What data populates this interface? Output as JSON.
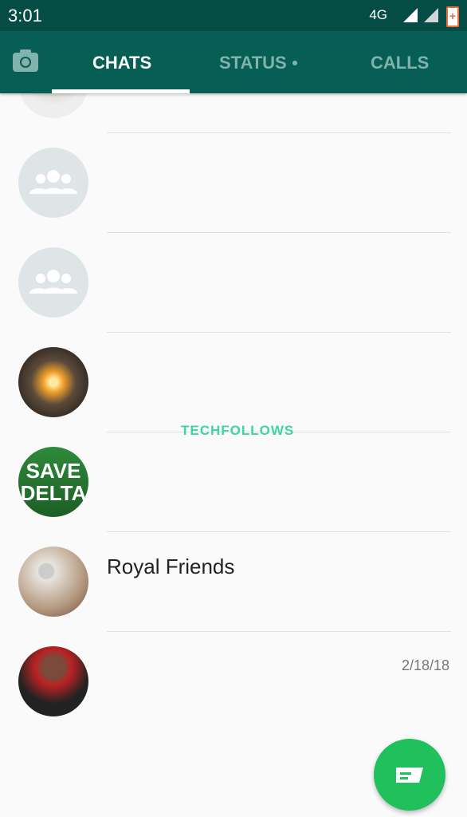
{
  "status_bar": {
    "time": "3:01",
    "network": "4G"
  },
  "tabs": [
    {
      "label": "CHATS",
      "active": true
    },
    {
      "label": "STATUS",
      "active": false,
      "has_update_dot": true
    },
    {
      "label": "CALLS",
      "active": false
    }
  ],
  "chats": [
    {
      "name": "",
      "avatar": "photo-person"
    },
    {
      "name": "",
      "avatar": "group-icon"
    },
    {
      "name": "",
      "avatar": "group-icon"
    },
    {
      "name": "",
      "avatar": "photo-lamp"
    },
    {
      "name": "",
      "avatar": "photo-save-delta",
      "avatar_text": "SAVE DELTA"
    },
    {
      "name": "Royal Friends",
      "avatar": "photo-person"
    },
    {
      "name": "",
      "date": "2/18/18",
      "avatar": "photo-child"
    }
  ],
  "watermark": "TECHFOLLOWS",
  "colors": {
    "header": "#075e54",
    "status_bar": "#054d44",
    "fab": "#20c05c"
  }
}
